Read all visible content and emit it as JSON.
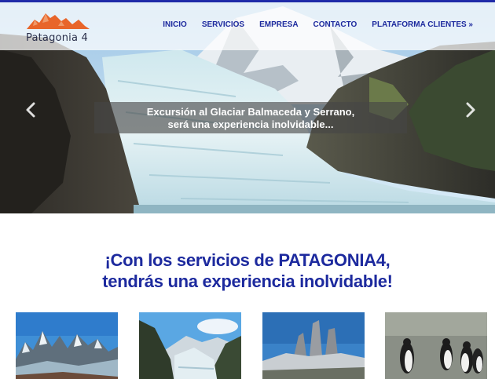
{
  "brand": {
    "name": "Patagonia 4",
    "accent": "#e8652a",
    "nav_color": "#1d2a9e"
  },
  "nav": {
    "items": [
      {
        "label": "INICIO"
      },
      {
        "label": "SERVICIOS"
      },
      {
        "label": "EMPRESA"
      },
      {
        "label": "CONTACTO"
      },
      {
        "label": "PLATAFORMA CLIENTES »"
      }
    ]
  },
  "hero": {
    "caption_line1": "Excursión al Glaciar Balmaceda y Serrano,",
    "caption_line2": "será una experiencia inolvidable...",
    "prev_icon": "chevron-left-icon",
    "next_icon": "chevron-right-icon"
  },
  "headline": {
    "line1": "¡Con los servicios de PATAGONIA4,",
    "line2": "tendrás una experiencia inolvidable!"
  },
  "thumbnails": [
    {
      "subject": "mountain-peaks-photo"
    },
    {
      "subject": "glacier-valley-photo"
    },
    {
      "subject": "granite-towers-photo"
    },
    {
      "subject": "penguins-photo"
    }
  ]
}
